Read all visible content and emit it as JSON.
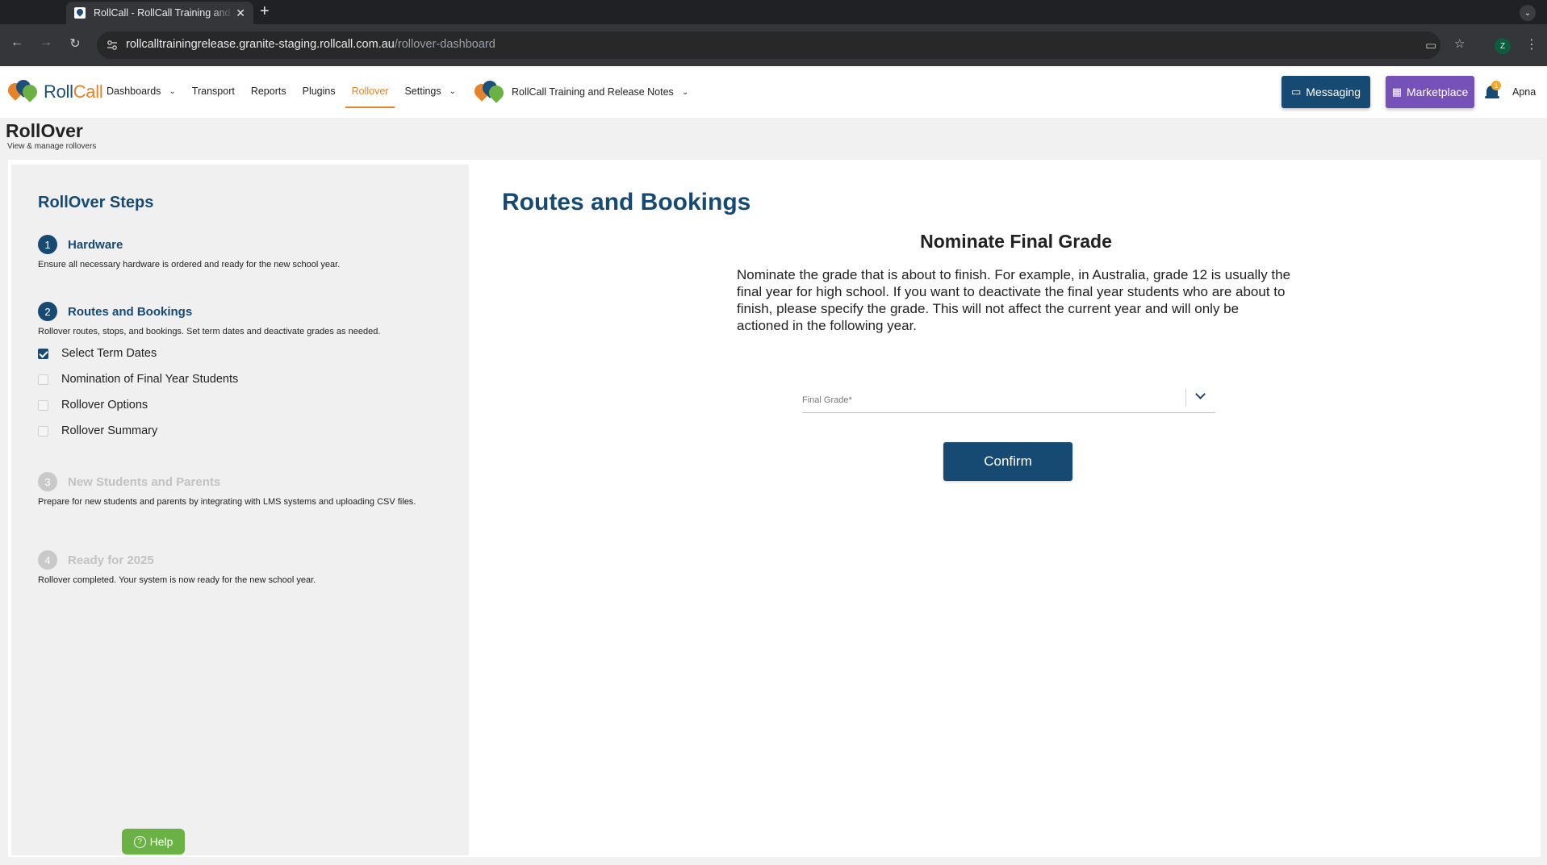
{
  "browser": {
    "tab_title": "RollCall - RollCall Training and",
    "tab_close": "✕",
    "new_tab": "+",
    "url_host": "rollcalltrainingrelease.granite-staging.rollcall.com.au",
    "url_path": "/rollover-dashboard",
    "profile_initial": "Z"
  },
  "app": {
    "logo_roll": "Roll",
    "logo_call": "Call",
    "nav": [
      {
        "label": "Dashboards",
        "has_menu": true
      },
      {
        "label": "Transport"
      },
      {
        "label": "Reports"
      },
      {
        "label": "Plugins"
      },
      {
        "label": "Rollover",
        "active": true
      },
      {
        "label": "Settings",
        "has_menu": true
      }
    ],
    "org_name": "RollCall Training and Release Notes",
    "messaging_label": "Messaging",
    "marketplace_label": "Marketplace",
    "notification_count": "1",
    "user_name": "Apna",
    "colors": {
      "primary": "#174a73",
      "accent": "#e5822a",
      "marketplace": "#7652b8",
      "help": "#6bb244"
    }
  },
  "page": {
    "title": "RollOver",
    "subtitle": "View & manage rollovers"
  },
  "steps_panel": {
    "heading": "RollOver Steps",
    "steps": [
      {
        "number": "1",
        "name": "Hardware",
        "description": "Ensure all necessary hardware is ordered and ready for the new school year.",
        "enabled": true
      },
      {
        "number": "2",
        "name": "Routes and Bookings",
        "description": "Rollover routes, stops, and bookings. Set term dates and deactivate grades as needed.",
        "enabled": true,
        "substeps": [
          {
            "label": "Select Term Dates",
            "checked": true
          },
          {
            "label": "Nomination of Final Year Students",
            "checked": false
          },
          {
            "label": "Rollover Options",
            "checked": false
          },
          {
            "label": "Rollover Summary",
            "checked": false
          }
        ]
      },
      {
        "number": "3",
        "name": "New Students and Parents",
        "description": "Prepare for new students and parents by integrating with LMS systems and uploading CSV files.",
        "enabled": false
      },
      {
        "number": "4",
        "name": "Ready for 2025",
        "description": "Rollover completed. Your system is now ready for the new school year.",
        "enabled": false
      }
    ],
    "help_label": "Help"
  },
  "main": {
    "section_title": "Routes and Bookings",
    "form_title": "Nominate Final Grade",
    "description": "Nominate the grade that is about to finish. For example, in Australia, grade 12 is usually the final year for high school. If you want to deactivate the final year students who are about to finish, please specify the grade. This will not affect the current year and will only be actioned in the following year.",
    "final_grade_label": "Final Grade*",
    "final_grade_value": "",
    "confirm_label": "Confirm"
  }
}
